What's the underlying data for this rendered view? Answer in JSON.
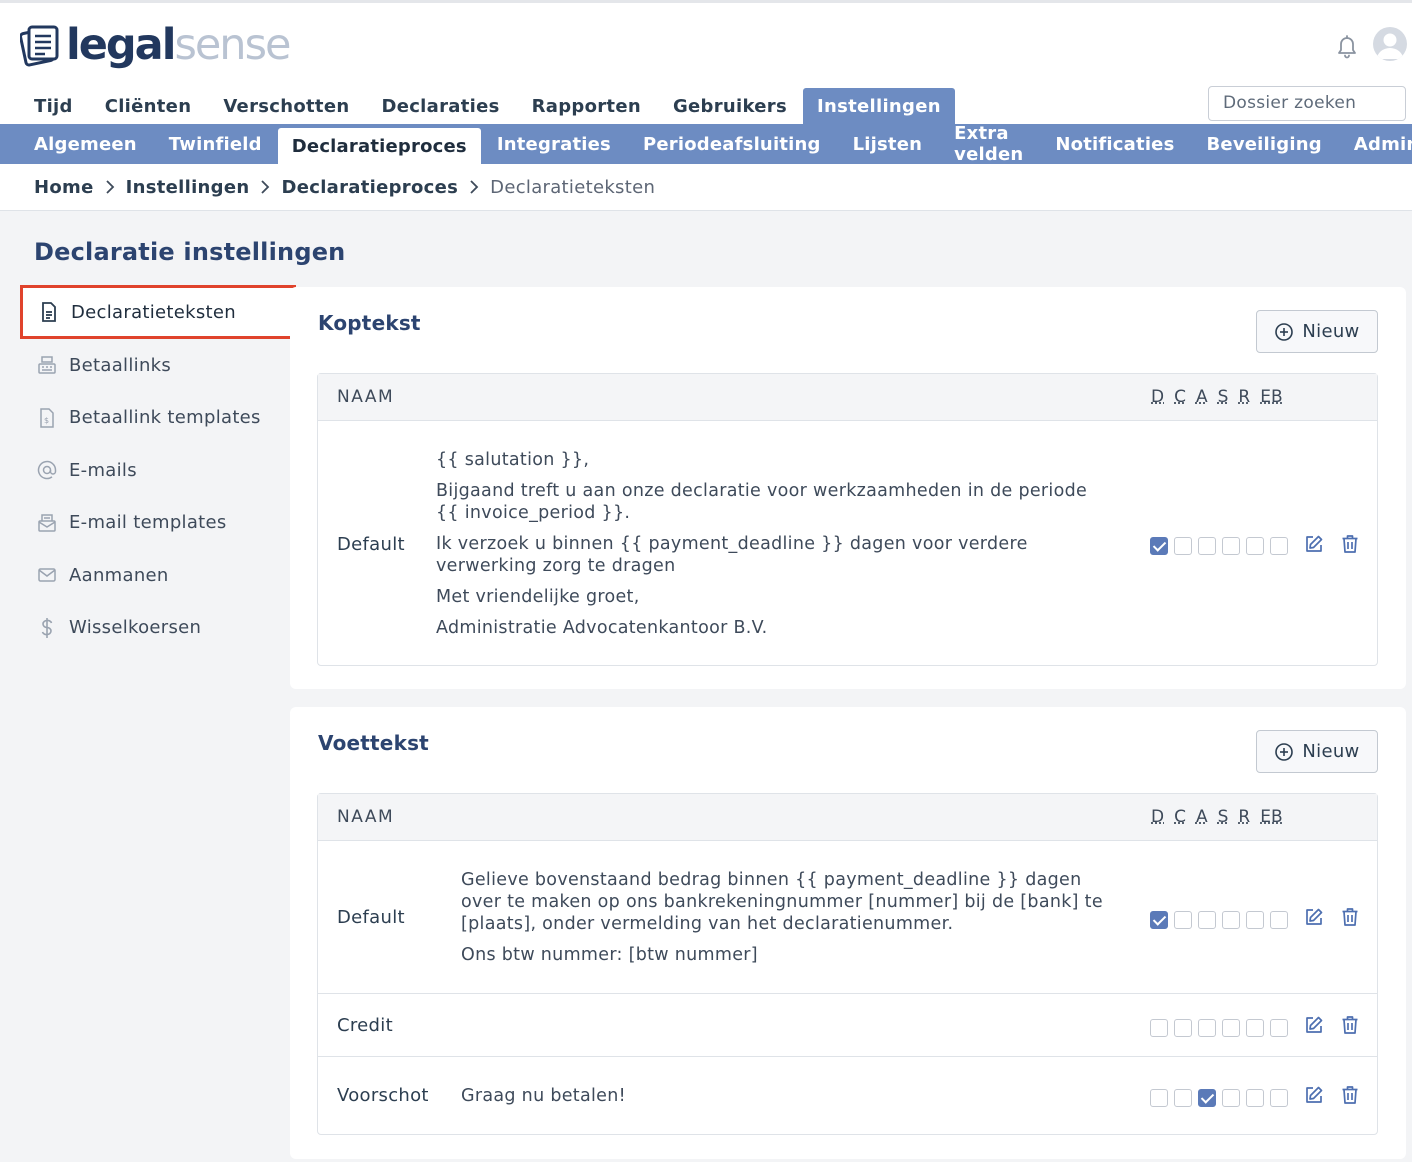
{
  "brand": {
    "part1": "legal",
    "part2": "sense"
  },
  "topnav": [
    "Tijd",
    "Cliënten",
    "Verschotten",
    "Declaraties",
    "Rapporten",
    "Gebruikers",
    "Instellingen"
  ],
  "search": {
    "placeholder": "Dossier zoeken"
  },
  "subnav": [
    "Algemeen",
    "Twinfield",
    "Declaratieproces",
    "Integraties",
    "Periodeafsluiting",
    "Lijsten",
    "Extra velden",
    "Notificaties",
    "Beveiliging",
    "Admin"
  ],
  "breadcrumb": [
    "Home",
    "Instellingen",
    "Declaratieproces",
    "Declaratieteksten"
  ],
  "page_title": "Declaratie instellingen",
  "sidebar": {
    "items": [
      {
        "label": "Declaratieteksten",
        "icon": "document-icon"
      },
      {
        "label": "Betaallinks",
        "icon": "register-icon"
      },
      {
        "label": "Betaallink templates",
        "icon": "invoice-icon"
      },
      {
        "label": "E-mails",
        "icon": "at-icon"
      },
      {
        "label": "E-mail templates",
        "icon": "mail-template-icon"
      },
      {
        "label": "Aanmanen",
        "icon": "envelope-icon"
      },
      {
        "label": "Wisselkoersen",
        "icon": "dollar-icon"
      }
    ]
  },
  "koptekst": {
    "title": "Koptekst",
    "new_label": "Nieuw",
    "col_name": "NAAM",
    "flags": [
      "D",
      "C",
      "A",
      "S",
      "R",
      "EB"
    ],
    "rows": [
      {
        "name": "Default",
        "lines": [
          "{{ salutation }},",
          "Bijgaand treft u aan onze declaratie voor werkzaamheden in de periode {{ invoice_period }}.",
          "Ik verzoek u binnen {{ payment_deadline }} dagen voor verdere verwerking zorg te dragen",
          "Met vriendelijke groet,",
          "Administratie Advocatenkantoor B.V."
        ],
        "checks": [
          true,
          false,
          false,
          false,
          false,
          false
        ]
      }
    ]
  },
  "voettekst": {
    "title": "Voettekst",
    "new_label": "Nieuw",
    "col_name": "NAAM",
    "flags": [
      "D",
      "C",
      "A",
      "S",
      "R",
      "EB"
    ],
    "rows": [
      {
        "name": "Default",
        "lines": [
          "Gelieve bovenstaand bedrag binnen {{ payment_deadline }} dagen over te maken op ons bankrekeningnummer [nummer] bij de [bank] te [plaats], onder vermelding van het declaratienummer.",
          "Ons btw nummer: [btw nummer]"
        ],
        "checks": [
          true,
          false,
          false,
          false,
          false,
          false
        ]
      },
      {
        "name": "Credit",
        "lines": [],
        "checks": [
          false,
          false,
          false,
          false,
          false,
          false
        ]
      },
      {
        "name": "Voorschot",
        "lines": [
          "Graag nu betalen!"
        ],
        "checks": [
          false,
          false,
          true,
          false,
          false,
          false
        ]
      }
    ]
  },
  "colors": {
    "nav_blue": "#6d8cc2",
    "brand_dark": "#22385e",
    "highlight_red": "#e0432c"
  }
}
